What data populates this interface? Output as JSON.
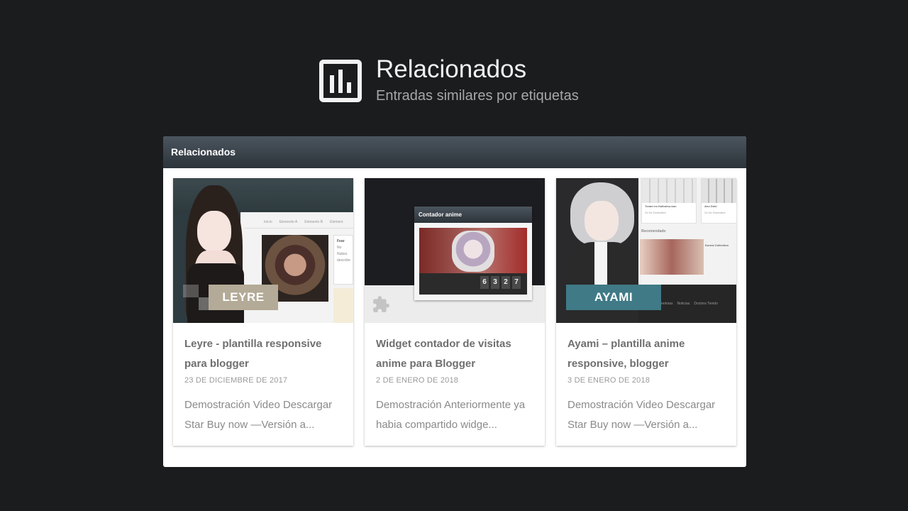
{
  "hero": {
    "title": "Relacionados",
    "subtitle": "Entradas similares por etiquetas",
    "icon": "bar-chart-icon"
  },
  "panel": {
    "header": "Relacionados"
  },
  "posts": [
    {
      "title": "Leyre - plantilla responsive para blogger",
      "date": "23 DE DICIEMBRE DE 2017",
      "excerpt": "Demostración Video Descargar Star Buy now —Versión a...",
      "thumb_label": "LEYRE",
      "thumb_nav": [
        "Inicio",
        "Elemento A",
        "Elemento B",
        "Element"
      ],
      "thumb_snip": [
        "Fear",
        "No Nubes",
        "describe"
      ]
    },
    {
      "title": "Widget contador de visitas anime para Blogger",
      "date": "2 DE ENERO DE 2018",
      "excerpt": "Demostración Anteriormente ya habia compartido widge...",
      "widget_title": "Contador anime",
      "counter_digits": [
        "6",
        "3",
        "2",
        "7"
      ]
    },
    {
      "title": "Ayami – plantilla anime responsive, blogger",
      "date": "3 DE ENERO DE 2018",
      "excerpt": "Demostración Video Descargar Star Buy now —Versión a...",
      "thumb_label": "AYAMI",
      "thumb_items": [
        "Tonari no Kaibutsu-kun",
        "Ano Doki",
        "24 De Diciembre",
        "24 De Diciembre",
        "Recomendado",
        "Kurosi Collection"
      ],
      "thumb_footer": [
        "Anentrass",
        "Noticias",
        "Doctora Tenido"
      ]
    }
  ],
  "colors": {
    "background": "#1b1c1e",
    "panel_header": "#3b444b",
    "leyre_tag": "#b3aa97",
    "ayami_tag": "#3f7a86"
  }
}
